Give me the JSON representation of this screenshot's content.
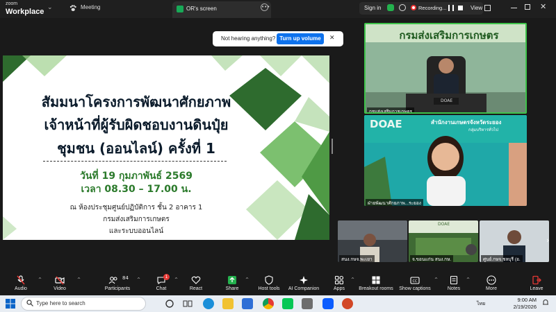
{
  "app": {
    "logo_top": "zoom",
    "logo_bottom": "Workplace",
    "meeting_tab": "Meeting",
    "screen_tab": "OR's screen"
  },
  "topbar": {
    "signin": "Sign in",
    "recording": "Recording...",
    "view": "View"
  },
  "notice": {
    "text": "Not hearing anything?",
    "button": "Turn up volume"
  },
  "slide": {
    "title_lines": [
      "สัมมนาโครงการพัฒนาศักยภาพ",
      "เจ้าหน้าที่ผู้รับผิดชอบงานดินปุ๋ย",
      "ชุมชน (ออนไลน์) ครั้งที่ 1"
    ],
    "date_line": "วันที่ 19 กุมภาพันธ์ 2569",
    "time_line": "เวลา 08.30 – 17.00 น.",
    "place_lines": [
      "ณ ห้องประชุมศูนย์ปฏิบัติการ ชั้น 2 อาคาร 1",
      "กรมส่งเสริมการเกษตร",
      "และระบบออนไลน์"
    ]
  },
  "video": {
    "tile1_banner": "กรมส่งเสริมการเกษตร",
    "tile1_name": "กรมส่งเสริมการเกษตร",
    "tile1_desk": "DOAE",
    "tile2_name": "ฝ่ายพัฒนาศักยภาพ...ระยอง",
    "tile2_banner": "สำนักงานเกษตรจังหวัดระยอง",
    "tile2_sub": "กลุ่มบริหารทั่วไป",
    "tile2_logo": "DOAE",
    "strip_names": [
      "สนง.กษจ.พะเยา",
      "จ.ขอนแก่น สนง.กษ.",
      "ศูนย์.กษจ.ชลบุรี (อ."
    ],
    "strip_logo": "DOAE"
  },
  "toolbar": {
    "audio": "Audio",
    "video": "Video",
    "participants": "Participants",
    "participants_count": "84",
    "chat": "Chat",
    "chat_badge": "1",
    "react": "React",
    "share": "Share",
    "host_tools": "Host tools",
    "ai_companion": "AI Companion",
    "apps": "Apps",
    "breakout": "Breakout rooms",
    "captions": "Show captions",
    "notes": "Notes",
    "more": "More",
    "leave": "Leave"
  },
  "taskbar": {
    "search_placeholder": "Type here to search",
    "lang": "ไทย",
    "time": "9:00 AM",
    "date": "2/19/2026"
  },
  "colors": {
    "green_dark": "#2e6b2e",
    "green_light": "#7cc06f",
    "accent_blue": "#0e72ed",
    "active_green": "#3ec34a",
    "mute_red": "#e53935"
  }
}
